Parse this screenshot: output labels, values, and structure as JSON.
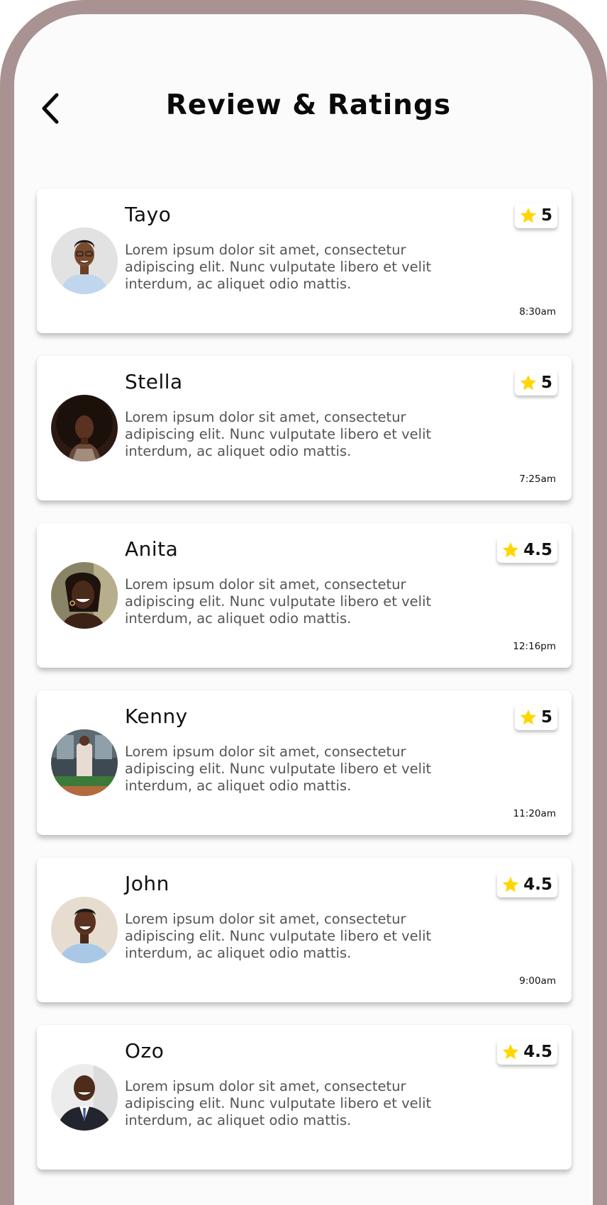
{
  "header": {
    "title": "Review & Ratings",
    "back_icon": "chevron-left-icon"
  },
  "colors": {
    "bezel": "#a89292",
    "screen": "#fbfbfb",
    "star": "#ffd600"
  },
  "reviews": [
    {
      "name": "Tayo",
      "text": "Lorem ipsum dolor sit amet, consectetur adipiscing elit. Nunc vulputate libero et velit interdum, ac aliquet odio mattis.",
      "rating": "5",
      "time": "8:30am",
      "avatar_icon": "avatar-man-glasses"
    },
    {
      "name": "Stella",
      "text": "Lorem ipsum dolor sit amet, consectetur adipiscing elit. Nunc vulputate libero et velit interdum, ac aliquet odio mattis.",
      "rating": "5",
      "time": "7:25am",
      "avatar_icon": "avatar-woman-afro"
    },
    {
      "name": "Anita",
      "text": "Lorem ipsum dolor sit amet, consectetur adipiscing elit. Nunc vulputate libero et velit interdum, ac aliquet odio mattis.",
      "rating": "4.5",
      "time": "12:16pm",
      "avatar_icon": "avatar-woman-smiling"
    },
    {
      "name": "Kenny",
      "text": "Lorem ipsum dolor sit amet, consectetur adipiscing elit. Nunc vulputate libero et velit interdum, ac aliquet odio mattis.",
      "rating": "5",
      "time": "11:20am",
      "avatar_icon": "avatar-person-outdoor"
    },
    {
      "name": "John",
      "text": "Lorem ipsum dolor sit amet, consectetur adipiscing elit. Nunc vulputate libero et velit interdum, ac aliquet odio mattis.",
      "rating": "4.5",
      "time": "9:00am",
      "avatar_icon": "avatar-man-laughing"
    },
    {
      "name": "Ozo",
      "text": "Lorem ipsum dolor sit amet, consectetur adipiscing elit. Nunc vulputate libero et velit interdum, ac aliquet odio mattis.",
      "rating": "4.5",
      "time": "",
      "avatar_icon": "avatar-man-suit"
    }
  ]
}
